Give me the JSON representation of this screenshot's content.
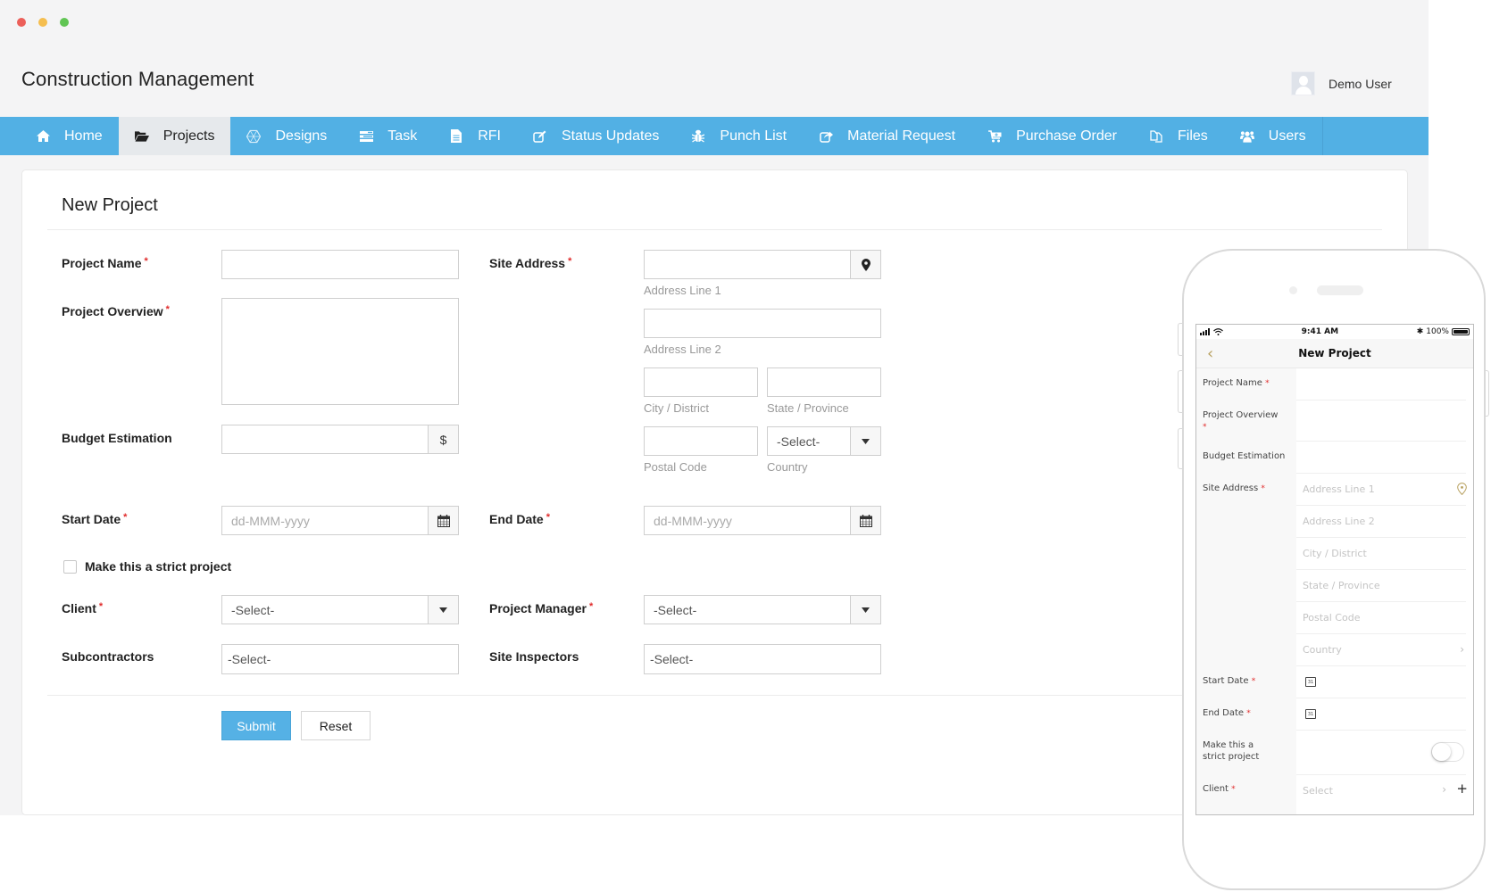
{
  "app": {
    "title": "Construction Management",
    "user_name": "Demo User"
  },
  "nav": {
    "items": [
      {
        "label": "Home",
        "icon": "home-icon",
        "active": false
      },
      {
        "label": "Projects",
        "icon": "folder-open-icon",
        "active": true
      },
      {
        "label": "Designs",
        "icon": "hexagon-design-icon",
        "active": false
      },
      {
        "label": "Task",
        "icon": "tasks-icon",
        "active": false
      },
      {
        "label": "RFI",
        "icon": "document-icon",
        "active": false
      },
      {
        "label": "Status Updates",
        "icon": "edit-icon",
        "active": false
      },
      {
        "label": "Punch List",
        "icon": "bug-icon",
        "active": false
      },
      {
        "label": "Material Request",
        "icon": "share-icon",
        "active": false
      },
      {
        "label": "Purchase Order",
        "icon": "cart-icon",
        "active": false
      },
      {
        "label": "Files",
        "icon": "files-icon",
        "active": false
      },
      {
        "label": "Users",
        "icon": "users-icon",
        "active": false
      }
    ]
  },
  "form": {
    "title": "New Project",
    "required_mark": "*",
    "project_name": {
      "label": "Project Name",
      "value": ""
    },
    "project_overview": {
      "label": "Project Overview",
      "value": ""
    },
    "budget_estimation": {
      "label": "Budget Estimation",
      "value": "",
      "addon": "$"
    },
    "site_address": {
      "label": "Site Address",
      "address_line1": {
        "caption": "Address Line 1",
        "value": ""
      },
      "address_line2": {
        "caption": "Address Line 2",
        "value": ""
      },
      "city": {
        "caption": "City / District",
        "value": ""
      },
      "state": {
        "caption": "State / Province",
        "value": ""
      },
      "postal_code": {
        "caption": "Postal Code",
        "value": ""
      },
      "country": {
        "caption": "Country",
        "value": "-Select-"
      }
    },
    "start_date": {
      "label": "Start Date",
      "placeholder": "dd-MMM-yyyy"
    },
    "end_date": {
      "label": "End Date",
      "placeholder": "dd-MMM-yyyy"
    },
    "strict_project": {
      "label": "Make this a strict project",
      "checked": false
    },
    "client": {
      "label": "Client",
      "value": "-Select-"
    },
    "project_manager": {
      "label": "Project Manager",
      "value": "-Select-"
    },
    "subcontractors": {
      "label": "Subcontractors",
      "value": "-Select-"
    },
    "site_inspectors": {
      "label": "Site Inspectors",
      "value": "-Select-"
    },
    "submit_label": "Submit",
    "reset_label": "Reset"
  },
  "mobile": {
    "status_time": "9:41 AM",
    "battery": "100%",
    "title": "New Project",
    "rows": {
      "project_name": "Project Name",
      "project_overview": "Project Overview",
      "budget_estimation": "Budget Estimation",
      "site_address": "Site Address",
      "address_line1": "Address Line 1",
      "address_line2": "Address Line 2",
      "city": "City / District",
      "state": "State / Province",
      "postal_code": "Postal Code",
      "country": "Country",
      "start_date": "Start Date",
      "end_date": "End Date",
      "strict_line1": "Make this a",
      "strict_line2": "strict project",
      "client": "Client",
      "client_placeholder": "Select"
    },
    "calendar_day": "31",
    "strict_toggle_on": false
  },
  "colors": {
    "nav_bg": "#52b0e4",
    "nav_active_bg": "#e6e9ec",
    "submit_bg": "#55b1e5",
    "required": "#e02b2b",
    "mobile_accent": "#b8a160"
  }
}
